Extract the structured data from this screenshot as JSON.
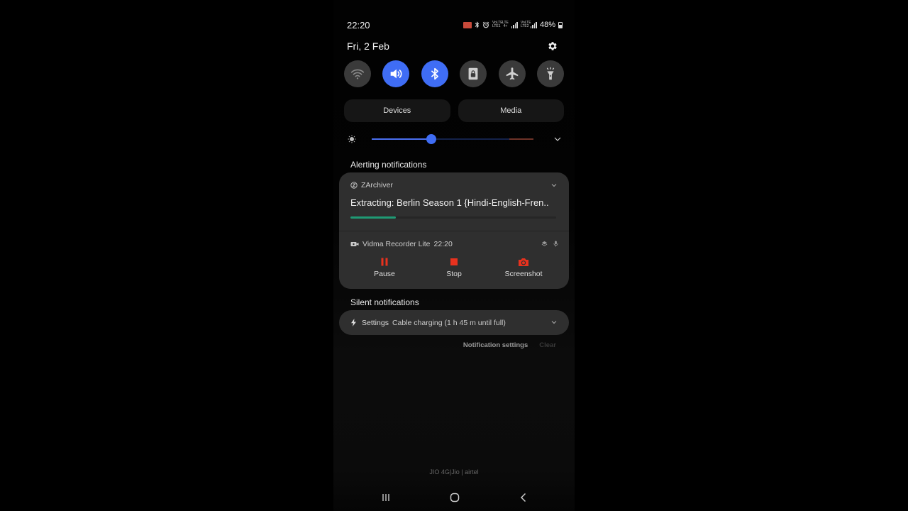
{
  "status_bar": {
    "time": "22:20",
    "icons": [
      "screen-cast-icon",
      "bluetooth-icon",
      "alarm-icon",
      "volte-lte1-icon",
      "lte-plus-icon",
      "signal-1-icon",
      "volte-lte2-icon",
      "signal-2-icon"
    ],
    "volte1_label": "VoLTE LTE1",
    "lte_label": "LTE 4+",
    "volte2_label": "VoLTE LTE2",
    "battery": "48%"
  },
  "header": {
    "date": "Fri, 2 Feb"
  },
  "quick_settings": [
    {
      "name": "wifi",
      "icon": "wifi-icon",
      "active": false
    },
    {
      "name": "sound",
      "icon": "volume-icon",
      "active": true
    },
    {
      "name": "bluetooth",
      "icon": "bluetooth-icon",
      "active": true
    },
    {
      "name": "secure-folder",
      "icon": "lock-folder-icon",
      "active": false
    },
    {
      "name": "airplane-mode",
      "icon": "airplane-icon",
      "active": false
    },
    {
      "name": "flashlight",
      "icon": "flashlight-icon",
      "active": false
    }
  ],
  "pills": {
    "devices": "Devices",
    "media": "Media"
  },
  "brightness": {
    "level": 0.37,
    "accent": "#3f6df5"
  },
  "sections": {
    "alerting": "Alerting notifications",
    "silent": "Silent notifications"
  },
  "notifications": {
    "zarchiver": {
      "app": "ZArchiver",
      "title": "Extracting: Berlin Season 1 {Hindi-English-Fren..",
      "progress": 0.22,
      "progress_color": "#1f9a74"
    },
    "vidma": {
      "app": "Vidma Recorder Lite",
      "time": "22:20",
      "actions": [
        {
          "label": "Pause",
          "icon": "pause-icon"
        },
        {
          "label": "Stop",
          "icon": "stop-icon"
        },
        {
          "label": "Screenshot",
          "icon": "camera-icon"
        }
      ],
      "action_color": "#e8321e"
    },
    "settings": {
      "app": "Settings",
      "message": "Cable charging (1 h 45 m until full)"
    }
  },
  "footer": {
    "notification_settings": "Notification settings",
    "clear": "Clear"
  },
  "carrier": "JIO 4G|Jio | airtel"
}
